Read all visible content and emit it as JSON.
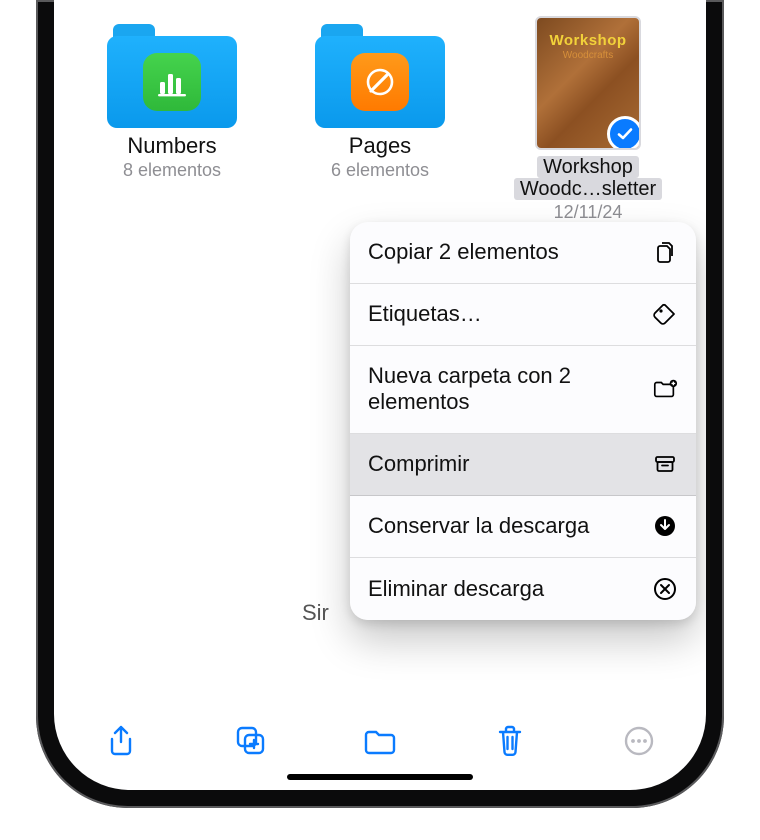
{
  "items": [
    {
      "name": "Numbers",
      "sub": "8 elementos"
    },
    {
      "name": "Pages",
      "sub": "6 elementos"
    },
    {
      "name_line1": "Workshop",
      "name_line2": "Woodc…sletter",
      "date": "12/11/24",
      "thumb_title": "Workshop",
      "thumb_sub": "Woodcrafts",
      "selected": true
    }
  ],
  "behind_text": "Sir",
  "menu": [
    {
      "label": "Copiar 2 elementos",
      "icon": "copy-icon",
      "highlight": false
    },
    {
      "label": "Etiquetas…",
      "icon": "tag-icon",
      "highlight": false
    },
    {
      "label": "Nueva carpeta con 2 elementos",
      "icon": "new-folder-icon",
      "highlight": false
    },
    {
      "label": "Comprimir",
      "icon": "archive-icon",
      "highlight": true
    },
    {
      "label": "Conservar la descarga",
      "icon": "download-keep-icon",
      "highlight": false
    },
    {
      "label": "Eliminar descarga",
      "icon": "remove-download-icon",
      "highlight": false
    }
  ],
  "toolbar": {
    "share": "share-icon",
    "duplicate": "duplicate-icon",
    "move": "move-folder-icon",
    "delete": "trash-icon",
    "more": "more-icon"
  },
  "colors": {
    "accent": "#0a7bff",
    "folder": "#12a2f2"
  }
}
